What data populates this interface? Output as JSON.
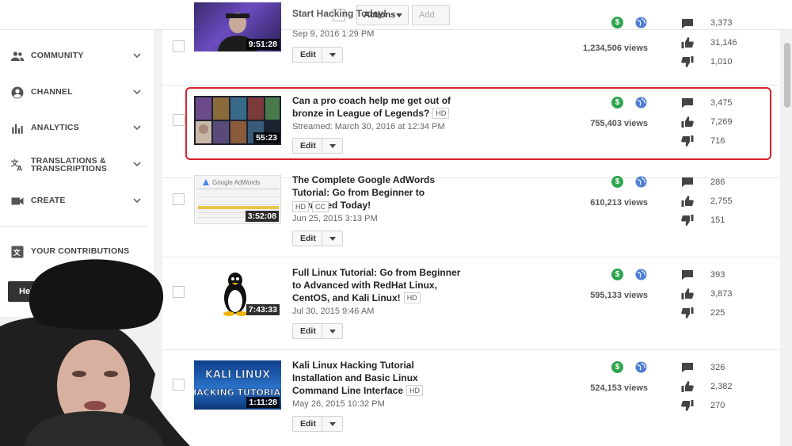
{
  "toolbar": {
    "actions_label": "Actions",
    "add_to_label": "Add to"
  },
  "sidebar": {
    "items": [
      {
        "label": "COMMUNITY",
        "icon": "people-icon"
      },
      {
        "label": "CHANNEL",
        "icon": "account-circle-icon"
      },
      {
        "label": "ANALYTICS",
        "icon": "bar-chart-icon"
      },
      {
        "label": "TRANSLATIONS & TRANSCRIPTIONS",
        "icon": "translate-icon"
      },
      {
        "label": "CREATE",
        "icon": "video-camera-icon"
      }
    ],
    "contributions_label": "YOUR CONTRIBUTIONS",
    "help_label": "Help"
  },
  "videos": [
    {
      "title": "Start Hacking Today!",
      "date": "Sep 9, 2016 1:29 PM",
      "duration": "9:51:28",
      "views": "1,234,506 views",
      "comments": "3,373",
      "likes": "31,146",
      "dislikes": "1,010",
      "edit_label": "Edit"
    },
    {
      "title": "Can a pro coach help me get out of bronze in League of Legends?",
      "badges": [
        "HD"
      ],
      "date": "Streamed: March 30, 2016 at 12:34 PM",
      "duration": "55:23",
      "views": "755,403 views",
      "comments": "3,475",
      "likes": "7,269",
      "dislikes": "716",
      "edit_label": "Edit"
    },
    {
      "title": "The Complete Google AdWords Tutorial: Go from Beginner to Advanced Today!",
      "badges": [
        "HD",
        "CC"
      ],
      "date": "Jun 25, 2015 3:13 PM",
      "duration": "3:52:08",
      "views": "610,213 views",
      "comments": "286",
      "likes": "2,755",
      "dislikes": "151",
      "edit_label": "Edit",
      "thumb_text": "Google AdWords"
    },
    {
      "title": "Full Linux Tutorial: Go from Beginner to Advanced with RedHat Linux, CentOS, and Kali Linux!",
      "badges": [
        "HD"
      ],
      "date": "Jul 30, 2015 9:46 AM",
      "duration": "7:43:33",
      "views": "595,133 views",
      "comments": "393",
      "likes": "3,873",
      "dislikes": "225",
      "edit_label": "Edit"
    },
    {
      "title": "Kali Linux Hacking Tutorial Installation and Basic Linux Command Line Interface",
      "badges": [
        "HD"
      ],
      "date": "May 26, 2015 10:32 PM",
      "duration": "1:11:28",
      "views": "524,153 views",
      "comments": "326",
      "likes": "2,382",
      "dislikes": "270",
      "edit_label": "Edit",
      "thumb_text_1": "KALI LINUX",
      "thumb_text_2": "HACKING TUTORIAL"
    }
  ],
  "colors": {
    "monetized": "#2fa44f",
    "public": "#4f7fd4",
    "highlight": "#d6232e"
  }
}
